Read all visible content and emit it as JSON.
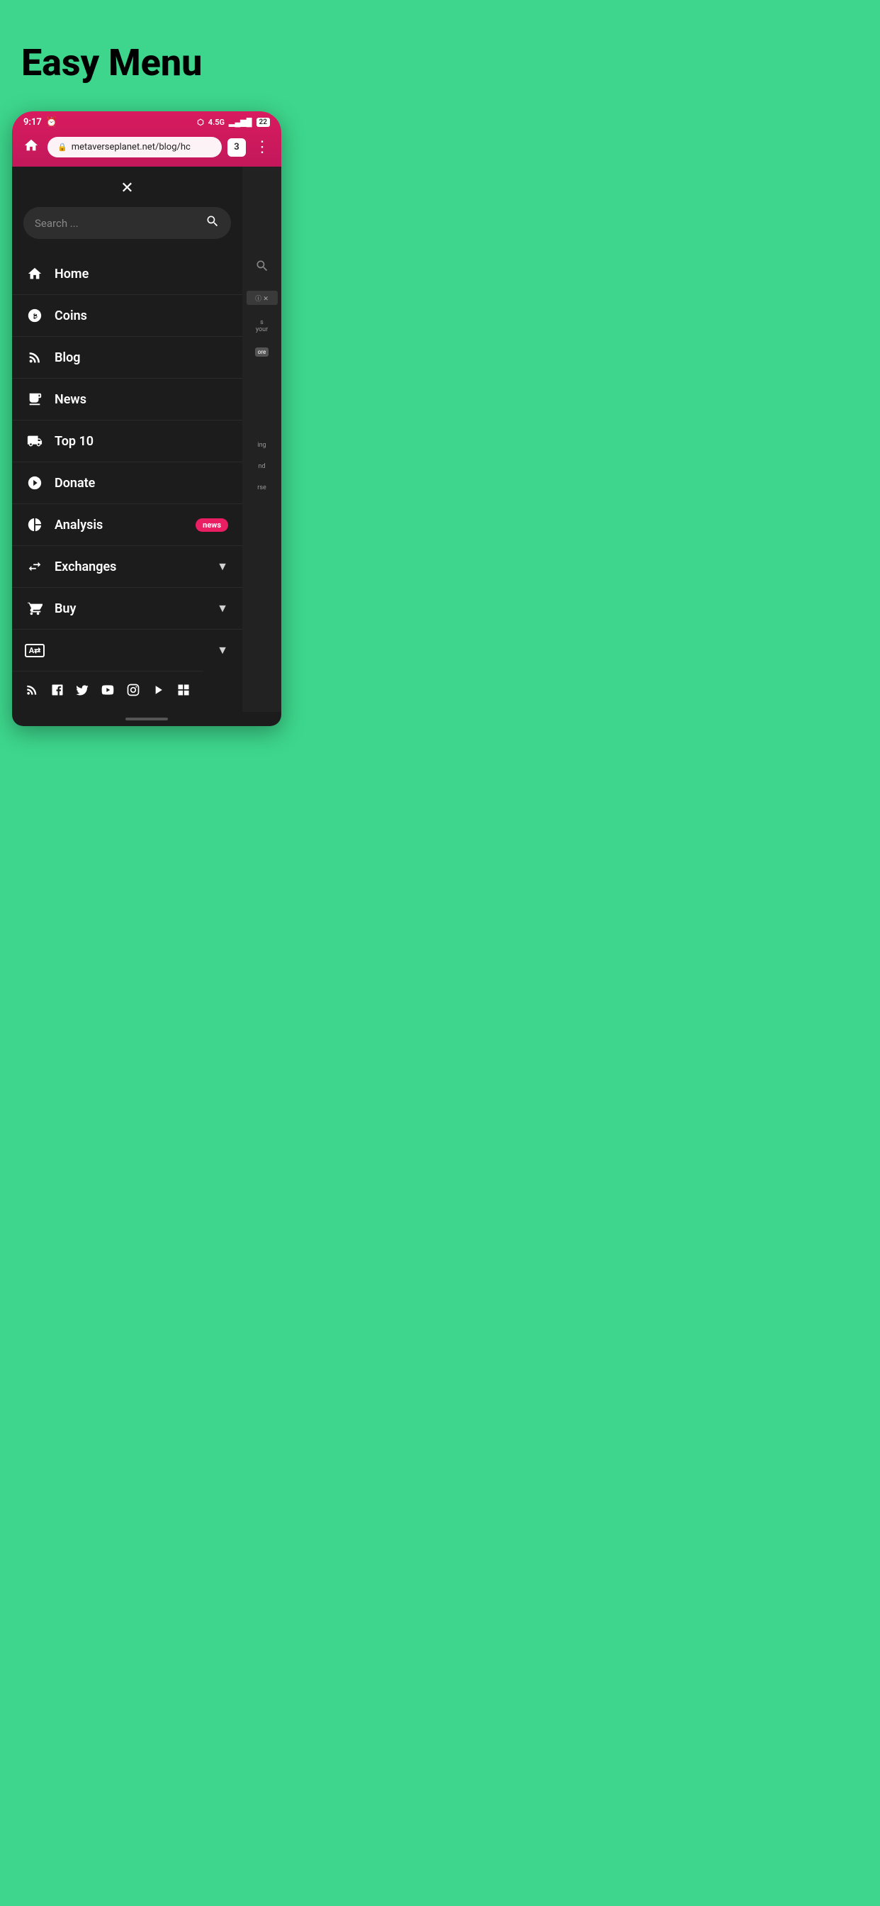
{
  "page": {
    "title": "Easy Menu",
    "background_color": "#3dd68c"
  },
  "status_bar": {
    "time": "9:17",
    "bluetooth": "⬡",
    "network": "4.5G",
    "signal": "▂▄▆█",
    "battery": "22"
  },
  "browser": {
    "url": "metaverseplanet.net/blog/hc",
    "tab_count": "3"
  },
  "menu": {
    "search_placeholder": "Search ...",
    "close_label": "✕",
    "items": [
      {
        "id": "home",
        "label": "Home",
        "icon": "home",
        "has_chevron": false,
        "badge": null
      },
      {
        "id": "coins",
        "label": "Coins",
        "icon": "bitcoin",
        "has_chevron": false,
        "badge": null
      },
      {
        "id": "blog",
        "label": "Blog",
        "icon": "blog",
        "has_chevron": false,
        "badge": null
      },
      {
        "id": "news",
        "label": "News",
        "icon": "newspaper",
        "has_chevron": false,
        "badge": null
      },
      {
        "id": "top10",
        "label": "Top 10",
        "icon": "truck",
        "has_chevron": false,
        "badge": null
      },
      {
        "id": "donate",
        "label": "Donate",
        "icon": "donate",
        "has_chevron": false,
        "badge": null
      },
      {
        "id": "analysis",
        "label": "Analysis",
        "icon": "chart",
        "has_chevron": false,
        "badge": "news"
      },
      {
        "id": "exchanges",
        "label": "Exchanges",
        "icon": "exchange",
        "has_chevron": true,
        "badge": null
      },
      {
        "id": "buy",
        "label": "Buy",
        "icon": "cart",
        "has_chevron": true,
        "badge": null
      },
      {
        "id": "language",
        "label": "",
        "icon": "af",
        "has_chevron": true,
        "badge": null
      }
    ]
  },
  "social": {
    "icons": [
      "rss",
      "facebook",
      "twitter",
      "youtube",
      "instagram",
      "play",
      "grid"
    ]
  }
}
